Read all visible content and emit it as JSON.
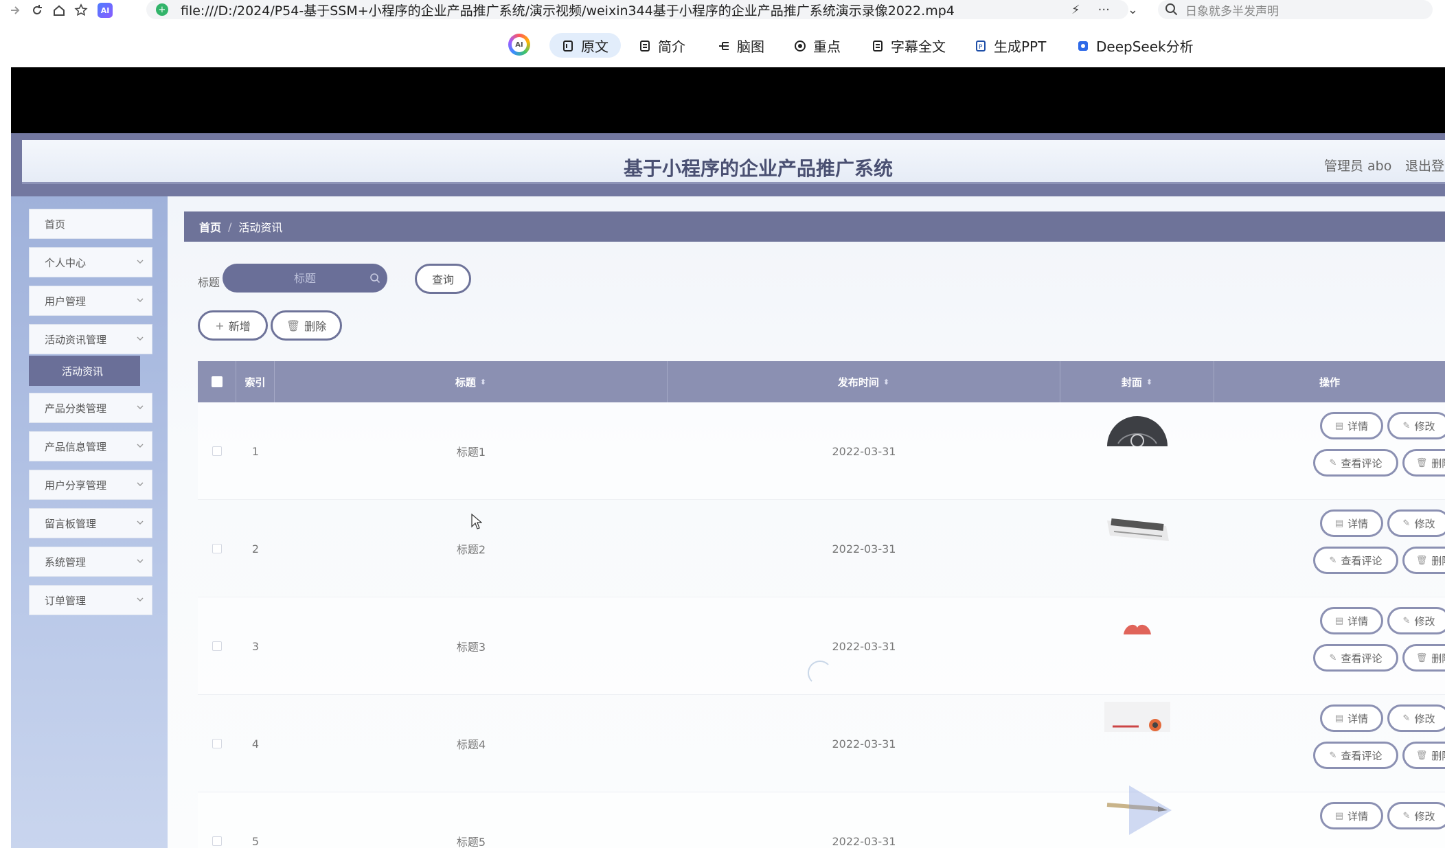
{
  "browser": {
    "url": "file:///D:/2024/P54-基于SSM+小程序的企业产品推广系统/演示视频/weixin344基于小程序的企业产品推广系统演示录像2022.mp4",
    "search_placeholder": "日象就多半发声明",
    "ai_badge": "AI"
  },
  "toolbar": {
    "logo": "AI",
    "items": [
      {
        "label": "原文",
        "icon": "document-icon"
      },
      {
        "label": "简介",
        "icon": "document-icon"
      },
      {
        "label": "脑图",
        "icon": "mindmap-icon"
      },
      {
        "label": "重点",
        "icon": "target-icon"
      },
      {
        "label": "字幕全文",
        "icon": "document-icon"
      },
      {
        "label": "生成PPT",
        "icon": "ppt-icon"
      },
      {
        "label": "DeepSeek分析",
        "icon": "deepseek-icon"
      }
    ]
  },
  "app": {
    "title": "基于小程序的企业产品推广系统",
    "user": "管理员 abo",
    "logout": "退出登"
  },
  "sidebar": {
    "items": [
      {
        "label": "首页",
        "expandable": false
      },
      {
        "label": "个人中心",
        "expandable": true
      },
      {
        "label": "用户管理",
        "expandable": true
      },
      {
        "label": "活动资讯管理",
        "expandable": true
      },
      {
        "label": "产品分类管理",
        "expandable": true
      },
      {
        "label": "产品信息管理",
        "expandable": true
      },
      {
        "label": "用户分享管理",
        "expandable": true
      },
      {
        "label": "留言板管理",
        "expandable": true
      },
      {
        "label": "系统管理",
        "expandable": true
      },
      {
        "label": "订单管理",
        "expandable": true
      }
    ],
    "active_submenu": "活动资讯"
  },
  "breadcrumb": {
    "home": "首页",
    "separator": "/",
    "current": "活动资讯"
  },
  "filter": {
    "label": "标题",
    "placeholder": "标题",
    "query_button": "查询",
    "add_button": "新增",
    "delete_button": "删除"
  },
  "table": {
    "columns": [
      "索引",
      "标题",
      "发布时间",
      "封面",
      "操作"
    ],
    "rows": [
      {
        "index": "1",
        "title": "标题1",
        "date": "2022-03-31",
        "cover": "globe"
      },
      {
        "index": "2",
        "title": "标题2",
        "date": "2022-03-31",
        "cover": "newspaper"
      },
      {
        "index": "3",
        "title": "标题3",
        "date": "2022-03-31",
        "cover": "lips"
      },
      {
        "index": "4",
        "title": "标题4",
        "date": "2022-03-31",
        "cover": "news-banner"
      },
      {
        "index": "5",
        "title": "标题5",
        "date": "2022-03-31",
        "cover": "pen"
      }
    ],
    "actions": {
      "detail": "详情",
      "edit": "修改",
      "comments": "查看评论",
      "delete": "删除"
    }
  },
  "colors": {
    "accent": "#6e7399",
    "header_bg": "#8b90b2",
    "sidebar_bg": "#b2c2e6"
  }
}
